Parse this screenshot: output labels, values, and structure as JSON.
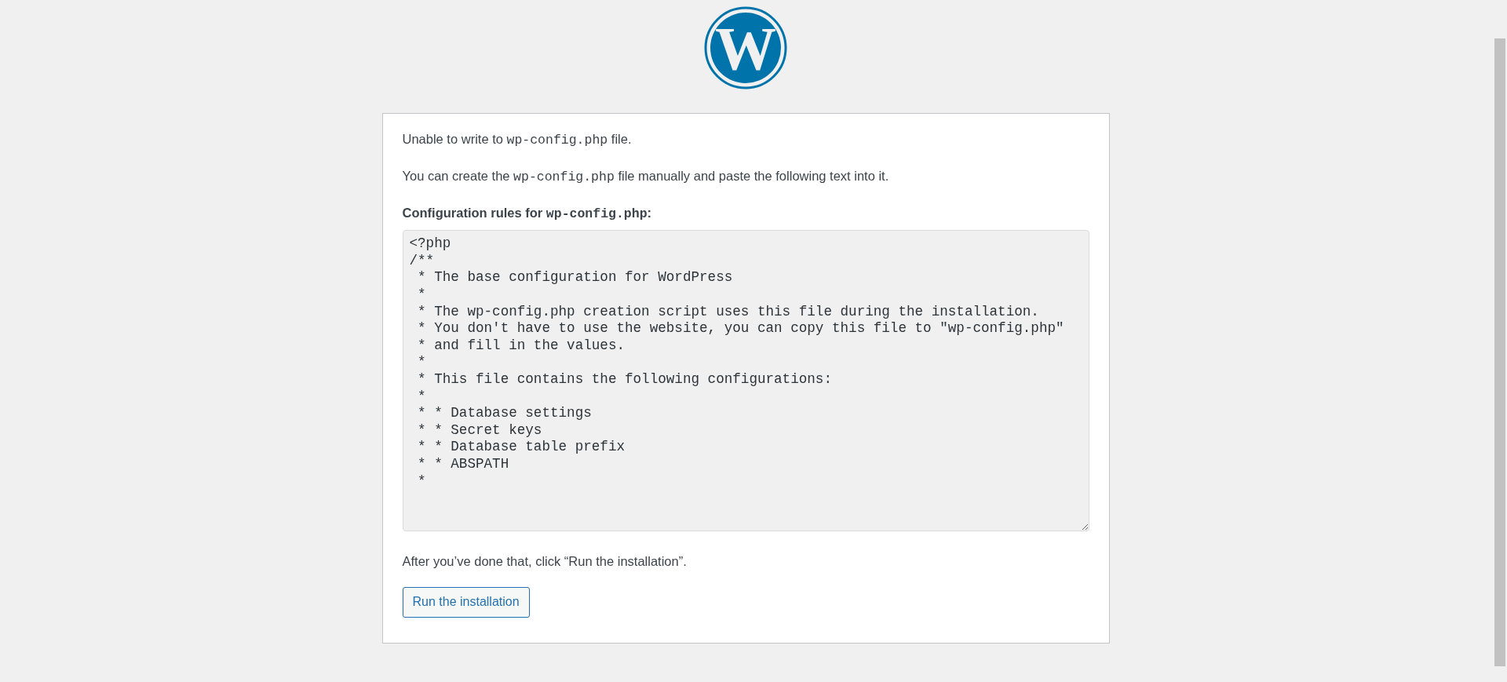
{
  "logo": {
    "letter": "W"
  },
  "messages": [
    {
      "parts": [
        {
          "kind": "text",
          "text": "Unable to write to "
        },
        {
          "kind": "code",
          "text": "wp-config.php"
        },
        {
          "kind": "text",
          "text": " file."
        }
      ]
    },
    {
      "parts": [
        {
          "kind": "text",
          "text": "You can create the "
        },
        {
          "kind": "code",
          "text": "wp-config.php"
        },
        {
          "kind": "text",
          "text": " file manually and paste the following text into it."
        }
      ]
    }
  ],
  "config_label": {
    "parts": [
      {
        "kind": "text",
        "text": "Configuration rules for "
      },
      {
        "kind": "code",
        "text": "wp-config.php"
      },
      {
        "kind": "text",
        "text": ":"
      }
    ]
  },
  "config_text": {
    "value": "<?php\n/**\n * The base configuration for WordPress\n *\n * The wp-config.php creation script uses this file during the installation.\n * You don't have to use the website, you can copy this file to \"wp-config.php\"\n * and fill in the values.\n *\n * This file contains the following configurations:\n *\n * * Database settings\n * * Secret keys\n * * Database table prefix\n * * ABSPATH\n *"
  },
  "instruction": "After you’ve done that, click “Run the installation”.",
  "button": {
    "label": "Run the installation"
  }
}
